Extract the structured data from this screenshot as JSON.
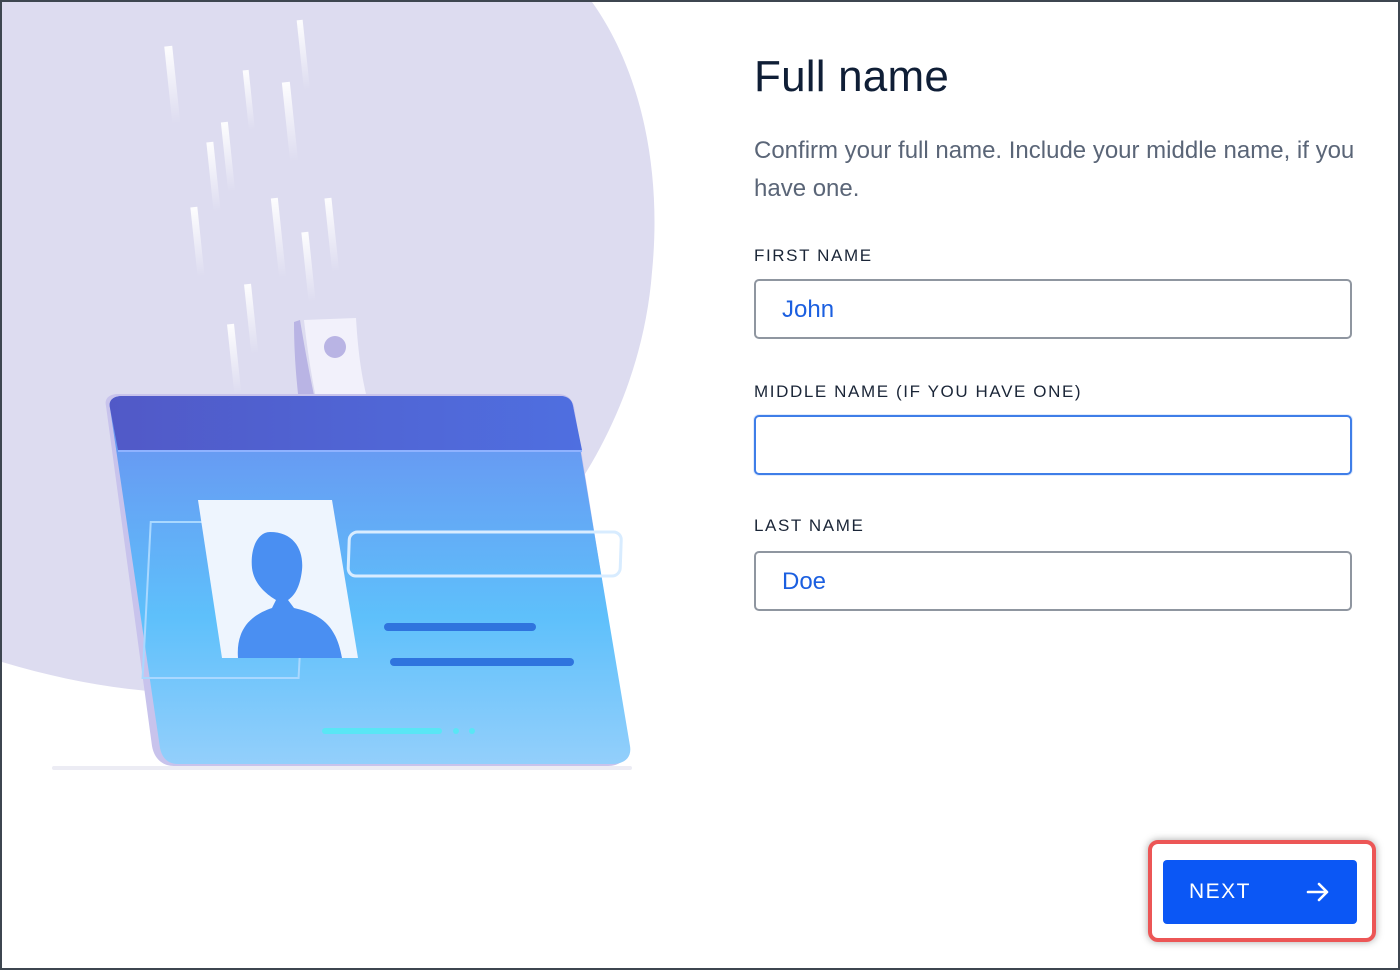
{
  "page": {
    "title": "Full name",
    "subtitle": "Confirm your full name. Include your middle name, if you have one."
  },
  "form": {
    "first_name": {
      "label": "FIRST NAME",
      "value": "John"
    },
    "middle_name": {
      "label": "MIDDLE NAME (IF YOU HAVE ONE)",
      "value": ""
    },
    "last_name": {
      "label": "LAST NAME",
      "value": "Doe"
    }
  },
  "actions": {
    "next_label": "NEXT",
    "next_icon": "arrow-right-icon"
  },
  "colors": {
    "accent": "#0b57f5",
    "input_text": "#1b5fe0",
    "highlight": "#ec5656",
    "blob": "#dddcf0"
  }
}
